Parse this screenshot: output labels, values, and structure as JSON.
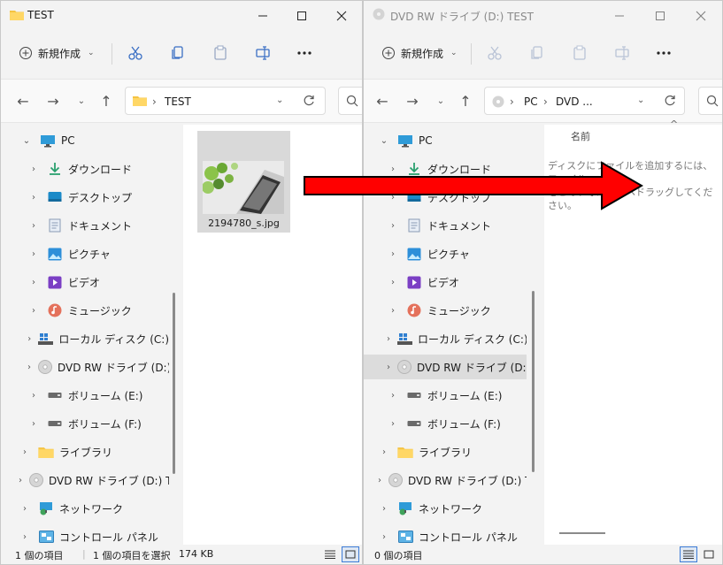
{
  "left_window": {
    "title": "TEST",
    "new_label": "新規作成",
    "breadcrumb": [
      "TEST"
    ],
    "tree": [
      {
        "label": "PC",
        "icon": "monitor-icon"
      },
      {
        "label": "ダウンロード",
        "icon": "download-icon"
      },
      {
        "label": "デスクトップ",
        "icon": "desktop-icon"
      },
      {
        "label": "ドキュメント",
        "icon": "document-icon"
      },
      {
        "label": "ピクチャ",
        "icon": "picture-icon"
      },
      {
        "label": "ビデオ",
        "icon": "video-icon"
      },
      {
        "label": "ミュージック",
        "icon": "music-icon"
      },
      {
        "label": "ローカル ディスク (C:)",
        "icon": "local-disk-icon"
      },
      {
        "label": "DVD RW ドライブ (D:) TE",
        "icon": "dvd-icon"
      },
      {
        "label": "ボリューム (E:)",
        "icon": "volume-icon"
      },
      {
        "label": "ボリューム (F:)",
        "icon": "volume-icon"
      },
      {
        "label": "ライブラリ",
        "icon": "folder-icon"
      },
      {
        "label": "DVD RW ドライブ (D:) TEST",
        "icon": "dvd-icon"
      },
      {
        "label": "ネットワーク",
        "icon": "network-icon"
      },
      {
        "label": "コントロール パネル",
        "icon": "control-panel-icon"
      }
    ],
    "file": {
      "name": "2194780_s.jpg"
    },
    "status": {
      "count": "1 個の項目",
      "selected": "1 個の項目を選択",
      "size": "174 KB"
    }
  },
  "right_window": {
    "title": "DVD RW ドライブ (D:) TEST",
    "new_label": "新規作成",
    "breadcrumb": [
      "PC",
      "DVD ..."
    ],
    "tree": [
      {
        "label": "PC",
        "icon": "monitor-icon"
      },
      {
        "label": "ダウンロード",
        "icon": "download-icon"
      },
      {
        "label": "デスクトップ",
        "icon": "desktop-icon"
      },
      {
        "label": "ドキュメント",
        "icon": "document-icon"
      },
      {
        "label": "ピクチャ",
        "icon": "picture-icon"
      },
      {
        "label": "ビデオ",
        "icon": "video-icon"
      },
      {
        "label": "ミュージック",
        "icon": "music-icon"
      },
      {
        "label": "ローカル ディスク (C:)",
        "icon": "local-disk-icon"
      },
      {
        "label": "DVD RW ドライブ (D:) TE",
        "icon": "dvd-icon"
      },
      {
        "label": "ボリューム (E:)",
        "icon": "volume-icon"
      },
      {
        "label": "ボリューム (F:)",
        "icon": "volume-icon"
      },
      {
        "label": "ライブラリ",
        "icon": "folder-icon"
      },
      {
        "label": "DVD RW ドライブ (D:) TEST",
        "icon": "dvd-icon"
      },
      {
        "label": "ネットワーク",
        "icon": "network-icon"
      },
      {
        "label": "コントロール パネル",
        "icon": "control-panel-icon"
      }
    ],
    "column_name": "名前",
    "empty_message_line1": "ディスクにファイルを追加するには、ファイル",
    "empty_message_line2": "をこのフォルダーへドラッグしてください。",
    "status": {
      "count": "0 個の項目"
    }
  },
  "colors": {
    "arrow_fill": "#ff0000",
    "arrow_stroke": "#000000",
    "folder": "#f5c342",
    "accent": "#3d7bd6"
  }
}
